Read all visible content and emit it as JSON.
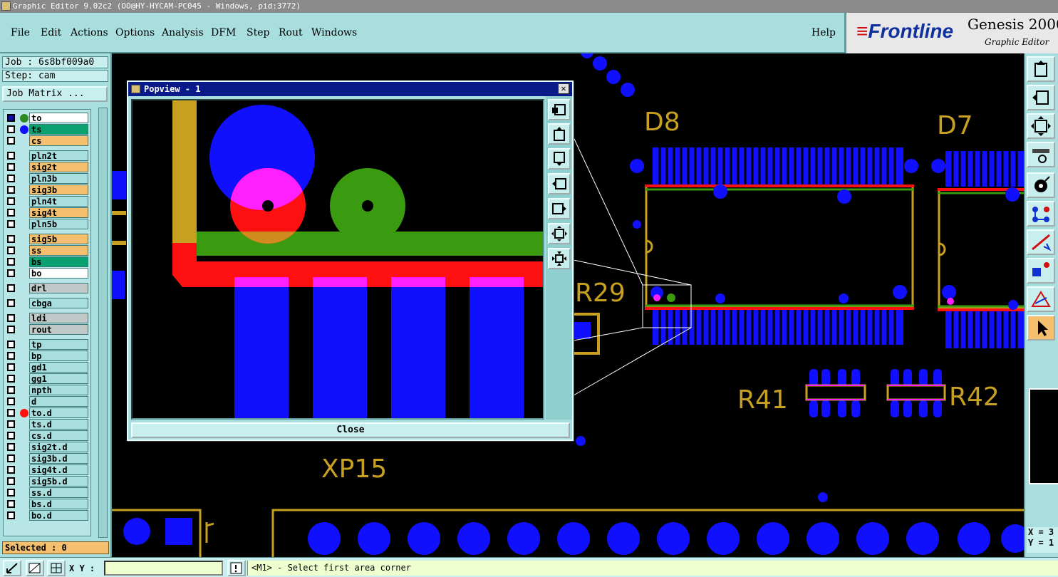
{
  "window": {
    "title": "Graphic Editor 9.02c2 (OO@HY-HYCAM-PC045 - Windows, pid:3772)"
  },
  "menu": {
    "items": [
      "File",
      "Edit",
      "Actions",
      "Options",
      "Analysis",
      "DFM",
      "Step",
      "Rout",
      "Windows"
    ],
    "help": "Help"
  },
  "brand": {
    "logo": "Frontline",
    "product": "Genesis 2000",
    "subtitle": "Graphic Editor"
  },
  "left_panel": {
    "job": "Job : 6s8bf009a0",
    "step": "Step: cam",
    "job_matrix": "Job Matrix ...",
    "layers": [
      {
        "name": "to",
        "color": "#ffffff",
        "dot": "#2e8b20",
        "checked": true
      },
      {
        "name": "ts",
        "color": "#0aa070",
        "dot": "#1010ff",
        "checked": false
      },
      {
        "name": "cs",
        "color": "#f4c070",
        "dot": "",
        "checked": false
      },
      {
        "name": "pln2t",
        "color": "#a8dede",
        "dot": "",
        "checked": false
      },
      {
        "name": "sig2t",
        "color": "#f4c070",
        "dot": "",
        "checked": false
      },
      {
        "name": "pln3b",
        "color": "#a8dede",
        "dot": "",
        "checked": false
      },
      {
        "name": "sig3b",
        "color": "#f4c070",
        "dot": "",
        "checked": false
      },
      {
        "name": "pln4t",
        "color": "#a8dede",
        "dot": "",
        "checked": false
      },
      {
        "name": "sig4t",
        "color": "#f4c070",
        "dot": "",
        "checked": false
      },
      {
        "name": "pln5b",
        "color": "#a8dede",
        "dot": "",
        "checked": false
      },
      {
        "name": "sig5b",
        "color": "#f4c070",
        "dot": "",
        "checked": false
      },
      {
        "name": "ss",
        "color": "#f4c070",
        "dot": "",
        "checked": false
      },
      {
        "name": "bs",
        "color": "#0aa070",
        "dot": "",
        "checked": false
      },
      {
        "name": "bo",
        "color": "#ffffff",
        "dot": "",
        "checked": false
      },
      {
        "name": "drl",
        "color": "#c0c8c8",
        "dot": "",
        "checked": false
      },
      {
        "name": "cbga",
        "color": "#a8dede",
        "dot": "",
        "checked": false
      },
      {
        "name": "ldi",
        "color": "#c0c8c8",
        "dot": "",
        "checked": false
      },
      {
        "name": "rout",
        "color": "#c0c8c8",
        "dot": "",
        "checked": false
      },
      {
        "name": "tp",
        "color": "#a8dede",
        "dot": "",
        "checked": false
      },
      {
        "name": "bp",
        "color": "#a8dede",
        "dot": "",
        "checked": false
      },
      {
        "name": "gd1",
        "color": "#a8dede",
        "dot": "",
        "checked": false
      },
      {
        "name": "gg1",
        "color": "#a8dede",
        "dot": "",
        "checked": false
      },
      {
        "name": "npth",
        "color": "#a8dede",
        "dot": "",
        "checked": false
      },
      {
        "name": "d",
        "color": "#a8dede",
        "dot": "",
        "checked": false
      },
      {
        "name": "to.d",
        "color": "#a8dede",
        "dot": "#ff1010",
        "checked": false
      },
      {
        "name": "ts.d",
        "color": "#a8dede",
        "dot": "",
        "checked": false
      },
      {
        "name": "cs.d",
        "color": "#a8dede",
        "dot": "",
        "checked": false
      },
      {
        "name": "sig2t.d",
        "color": "#a8dede",
        "dot": "",
        "checked": false
      },
      {
        "name": "sig3b.d",
        "color": "#a8dede",
        "dot": "",
        "checked": false
      },
      {
        "name": "sig4t.d",
        "color": "#a8dede",
        "dot": "",
        "checked": false
      },
      {
        "name": "sig5b.d",
        "color": "#a8dede",
        "dot": "",
        "checked": false
      },
      {
        "name": "ss.d",
        "color": "#a8dede",
        "dot": "",
        "checked": false
      },
      {
        "name": "bs.d",
        "color": "#a8dede",
        "dot": "",
        "checked": false
      },
      {
        "name": "bo.d",
        "color": "#a8dede",
        "dot": "",
        "checked": false
      }
    ],
    "selected": "Selected : 0"
  },
  "board": {
    "labels": [
      "D8",
      "D7",
      "R29",
      "R41",
      "R42",
      "XP15"
    ],
    "colors": {
      "pad": "#1010ff",
      "outline": "#c8a020",
      "red": "#ff1010",
      "green": "#3a9a10",
      "magenta": "#ff20ff"
    }
  },
  "popview": {
    "title": "Popview - 1",
    "close_button": "Close",
    "tool_icons": [
      "zoom-home-icon",
      "pan-up-icon",
      "pan-down-icon",
      "pan-left-icon",
      "pan-right-icon",
      "zoom-in-icon",
      "zoom-out-icon"
    ]
  },
  "right_toolbar": {
    "icons": [
      "pan-up-icon",
      "pan-left-icon",
      "zoom-fit-icon",
      "measure-icon",
      "select-feature-icon",
      "net-icon",
      "add-line-icon",
      "pad-icon",
      "drc-icon",
      "pointer-icon"
    ],
    "coords": {
      "x": "X = 3",
      "y": "Y = 1"
    }
  },
  "status": {
    "xy_label": "X Y :",
    "xy_value": "",
    "message": "<M1> - Select first area corner"
  }
}
